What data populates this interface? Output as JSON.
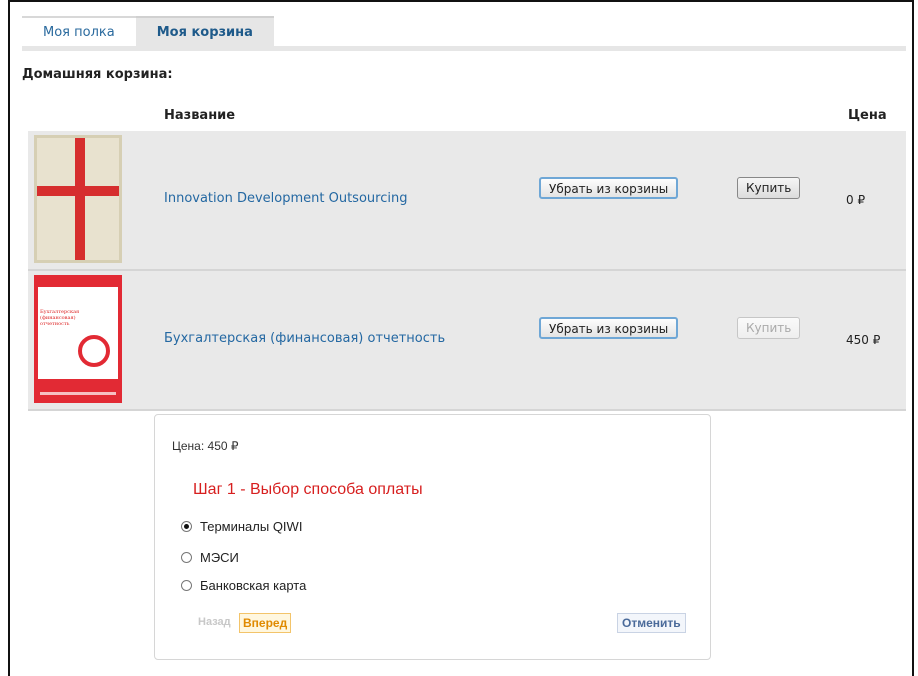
{
  "tabs": [
    {
      "label": "Моя полка"
    },
    {
      "label": "Моя корзина"
    }
  ],
  "section_title": "Домашняя корзина:",
  "columns": {
    "name": "Название",
    "price": "Цена"
  },
  "items": [
    {
      "title": "Innovation Development Outsourcing",
      "remove_label": "Убрать из корзины",
      "buy_label": "Купить",
      "buy_enabled": true,
      "price": "0 ₽"
    },
    {
      "title": "Бухгалтерская (финансовая) отчетность",
      "remove_label": "Убрать из корзины",
      "buy_label": "Купить",
      "buy_enabled": false,
      "price": "450 ₽",
      "cover_text": "Бухгалтерская (финансовая) отчетность"
    }
  ],
  "payment": {
    "price": "Цена: 450 ₽",
    "step_title": "Шаг 1 - Выбор способа оплаты",
    "options": [
      {
        "label": "Терминалы QIWI",
        "selected": true
      },
      {
        "label": "МЭСИ",
        "selected": false
      },
      {
        "label": "Банковская карта",
        "selected": false
      }
    ],
    "back_label": "Назад",
    "forward_label": "Вперед",
    "cancel_label": "Отменить"
  },
  "colors": {
    "accent_link": "#2468a2",
    "step_title": "#d71f1f",
    "forward": "#e08a00"
  }
}
